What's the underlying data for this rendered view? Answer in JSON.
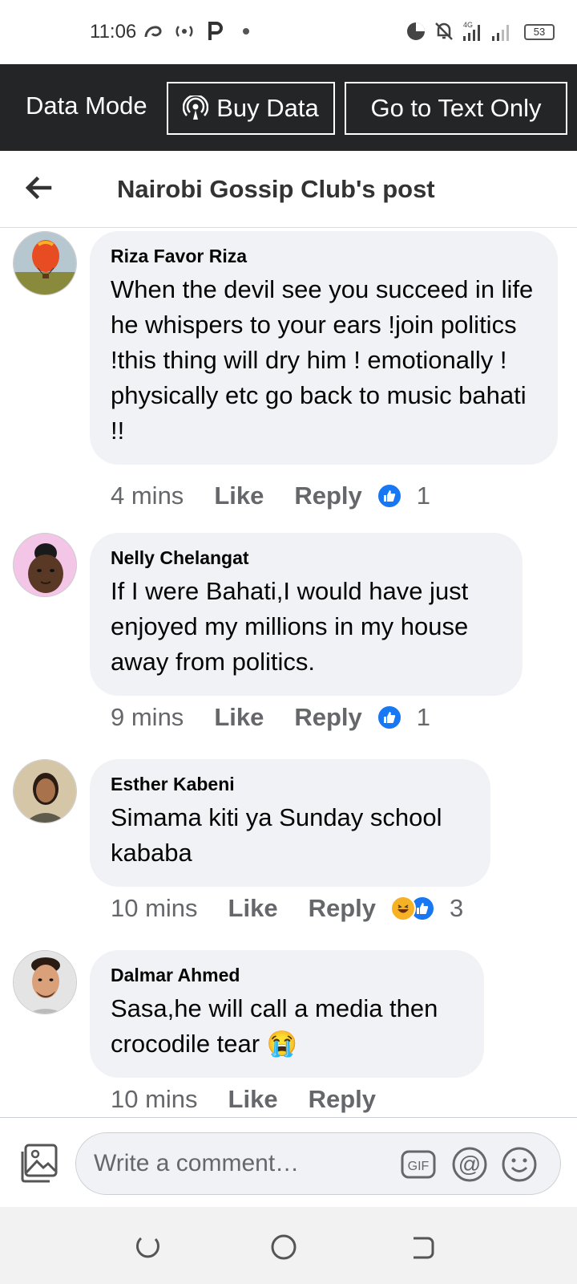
{
  "status_bar": {
    "time": "11:06",
    "battery": "53",
    "icons": [
      "swirl-icon",
      "hotspot-icon",
      "p-icon",
      "dot-icon",
      "data-saver-icon",
      "mute-icon",
      "signal-4g-icon",
      "signal-icon",
      "battery-icon"
    ],
    "network": "4G"
  },
  "data_mode": {
    "label": "Data Mode",
    "buy_data": "Buy Data",
    "text_only": "Go to Text Only"
  },
  "header": {
    "title": "Nairobi Gossip Club's post"
  },
  "comments": [
    {
      "author": "Riza Favor Riza",
      "text": "When the devil see you succeed in life he whispers to your ears !join politics !this thing will dry him ! emotionally ! physically etc go back to music bahati !!",
      "time": "4 mins",
      "like": "Like",
      "reply": "Reply",
      "reactions": [
        "like"
      ],
      "reaction_count": "1"
    },
    {
      "author": "Nelly Chelangat",
      "text": "If I were Bahati,I would have just enjoyed my millions in my house away from politics.",
      "time": "9 mins",
      "like": "Like",
      "reply": "Reply",
      "reactions": [
        "like"
      ],
      "reaction_count": "1"
    },
    {
      "author": "Esther Kabeni",
      "text": "Simama kiti ya Sunday school kababa",
      "time": "10 mins",
      "like": "Like",
      "reply": "Reply",
      "reactions": [
        "haha",
        "like"
      ],
      "reaction_count": "3"
    },
    {
      "author": "Dalmar Ahmed",
      "text": "Sasa,he will call a media then crocodile tear 😭",
      "time": "10 mins",
      "like": "Like",
      "reply": "Reply",
      "reactions": [],
      "reaction_count": ""
    }
  ],
  "composer": {
    "placeholder": "Write a comment…",
    "gif": "GIF",
    "mention": "@"
  },
  "colors": {
    "data_bar": "#242526",
    "bubble": "#f0f2f5",
    "like_blue": "#1877f2",
    "meta_gray": "#65676b"
  }
}
